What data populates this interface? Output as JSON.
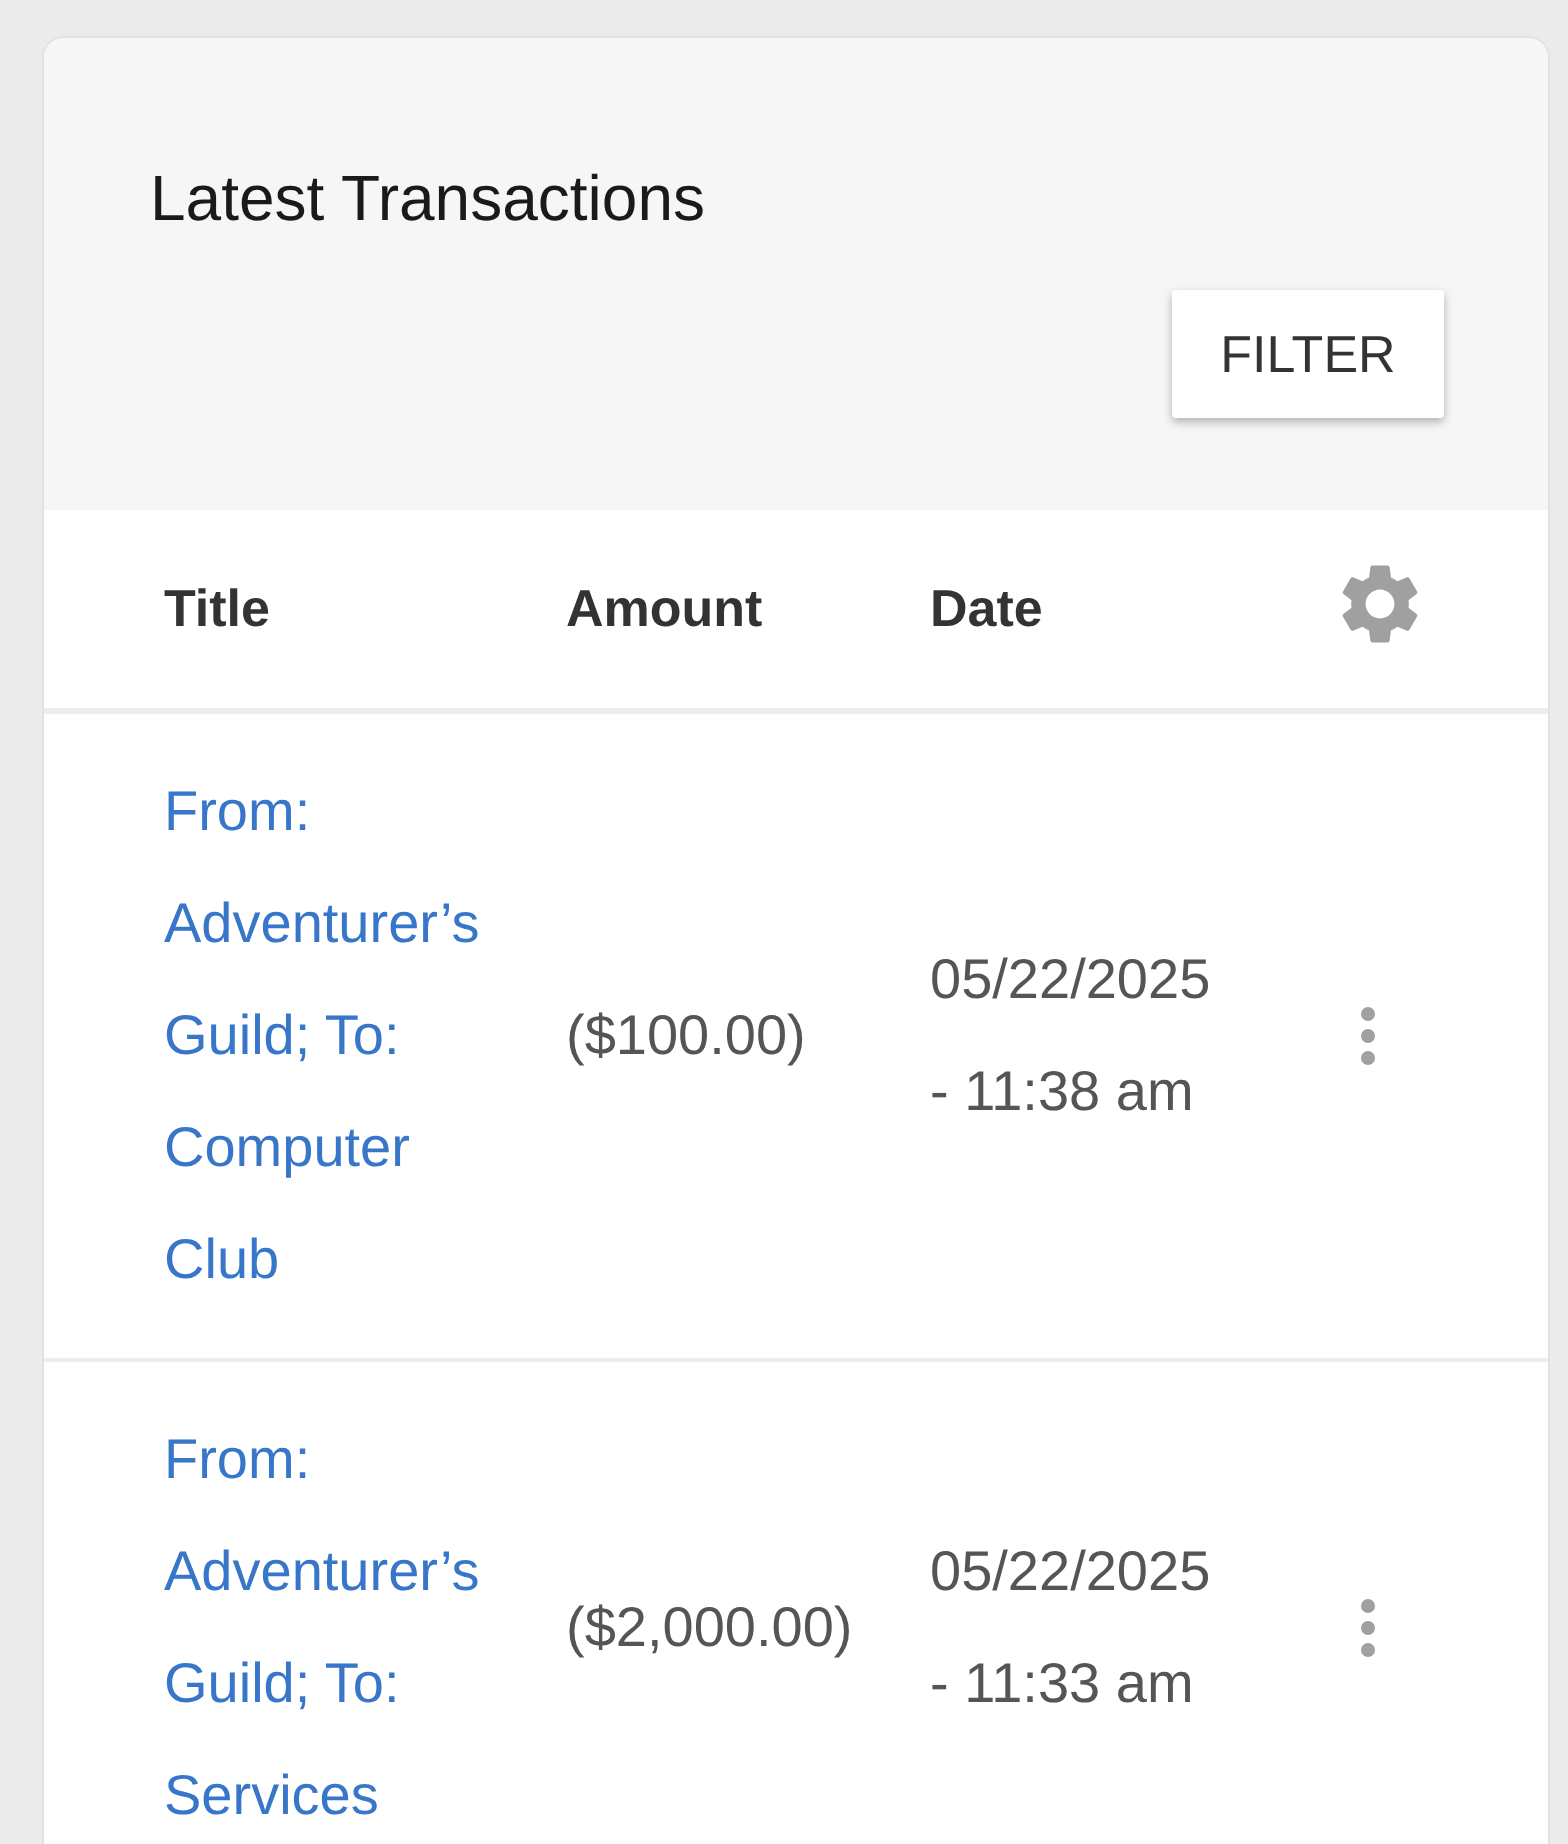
{
  "card": {
    "title": "Latest Transactions",
    "filter_button": "FILTER"
  },
  "table": {
    "columns": [
      "Title",
      "Amount",
      "Date"
    ],
    "rows": [
      {
        "title": "From: Adventurer’s Guild; To: Computer Club",
        "amount": "($100.00)",
        "date": "05/22/2025 - 11:38 am"
      },
      {
        "title": "From: Adventurer’s Guild; To: Services",
        "amount": "($2,000.00)",
        "date": "05/22/2025 - 11:33 am"
      }
    ]
  }
}
